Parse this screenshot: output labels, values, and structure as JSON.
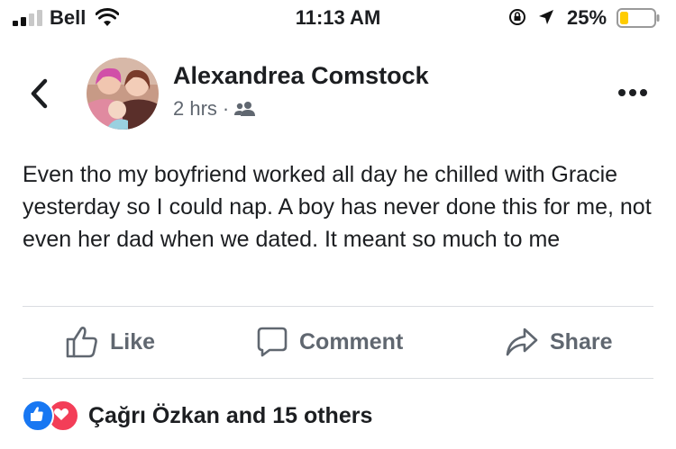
{
  "status_bar": {
    "carrier": "Bell",
    "time": "11:13 AM",
    "battery_percent": "25%",
    "battery_level": 0.25,
    "battery_color": "#ffcc00"
  },
  "post": {
    "author": "Alexandrea Comstock",
    "time_ago": "2 hrs",
    "separator": "·",
    "audience_icon": "friends-icon",
    "text": "Even tho my boyfriend worked all day he chilled with Gracie yesterday so I could nap. A boy has never done this for me, not even her dad when we dated. It meant so much to me"
  },
  "actions": {
    "like": "Like",
    "comment": "Comment",
    "share": "Share"
  },
  "reactions": {
    "summary": "Çağrı Özkan and 15 others",
    "like_color": "#1877f2",
    "love_color": "#f33e58"
  }
}
